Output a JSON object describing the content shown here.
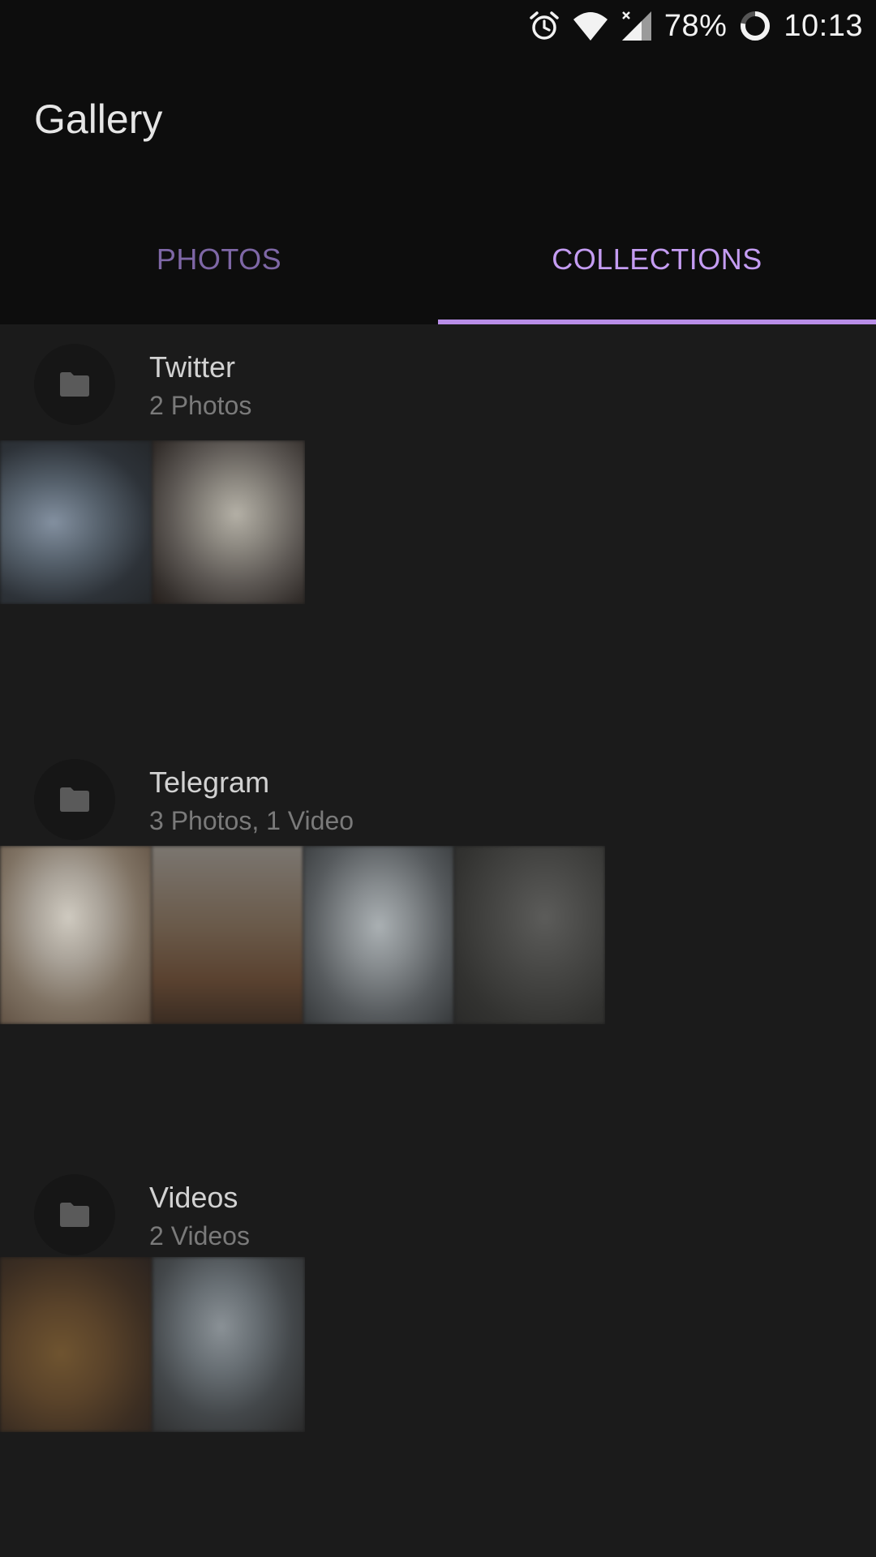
{
  "status_bar": {
    "battery": "78%",
    "time": "10:13",
    "icons": [
      "alarm-icon",
      "wifi-icon",
      "signal-icon",
      "battery-ring-icon"
    ]
  },
  "app_bar": {
    "title": "Gallery"
  },
  "tabs": [
    {
      "label": "PHOTOS",
      "active": false
    },
    {
      "label": "COLLECTIONS",
      "active": true
    }
  ],
  "colors": {
    "background": "#1b1b1b",
    "bar_background": "#0d0d0d",
    "accent": "#c49cf2",
    "inactive_tab": "#7e67a6"
  },
  "collections": [
    {
      "name": "Twitter",
      "count": "2 Photos",
      "icon": "folder-icon"
    },
    {
      "name": "Telegram",
      "count": "3 Photos, 1 Video",
      "icon": "folder-icon"
    },
    {
      "name": "Videos",
      "count": "2 Videos",
      "icon": "folder-icon"
    }
  ]
}
